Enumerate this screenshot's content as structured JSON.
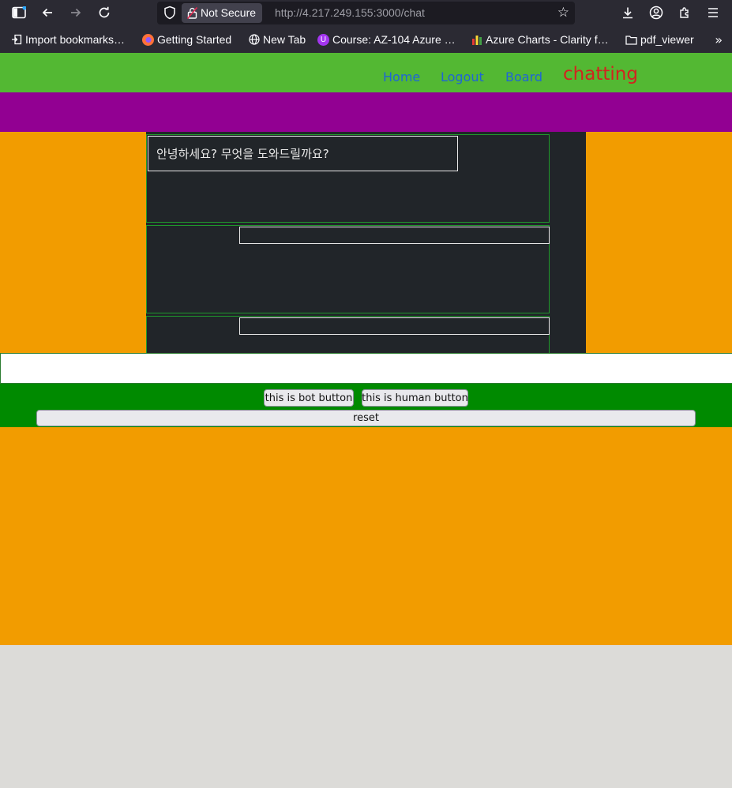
{
  "browser": {
    "security_label": "Not Secure",
    "url_host": "http://4.217.249.155",
    "url_path": ":3000/chat",
    "icons": [
      "sidebar-icon",
      "back-icon",
      "forward-icon",
      "reload-icon",
      "shield-icon",
      "lock-icon",
      "star-icon",
      "download-icon",
      "account-icon",
      "extensions-icon",
      "menu-icon"
    ],
    "bookmarks": [
      {
        "label": "Import bookmarks…",
        "icon": "import-icon"
      },
      {
        "label": "Getting Started",
        "icon": "firefox-icon"
      },
      {
        "label": "New Tab",
        "icon": "globe-icon"
      },
      {
        "label": "Course: AZ-104 Azure …",
        "icon": "course-icon"
      },
      {
        "label": "Azure Charts - Clarity f…",
        "icon": "azure-charts-icon"
      },
      {
        "label": "pdf_viewer",
        "icon": "folder-icon"
      }
    ]
  },
  "nav": {
    "home": "Home",
    "logout": "Logout",
    "board": "Board",
    "active": "chatting"
  },
  "chat": {
    "bot_greeting": "안녕하세요? 무엇을 도와드릴까요?",
    "input_value": "",
    "bot_button": "this is bot button",
    "human_button": "this is human button",
    "reset_button": "reset"
  },
  "colors": {
    "navbar": "#53b833",
    "band": "#920092",
    "page": "#f29c00",
    "chat_bg": "#212529",
    "buttons_bar": "#008a00",
    "active_link": "#d2231f",
    "link": "#1f65d6"
  }
}
